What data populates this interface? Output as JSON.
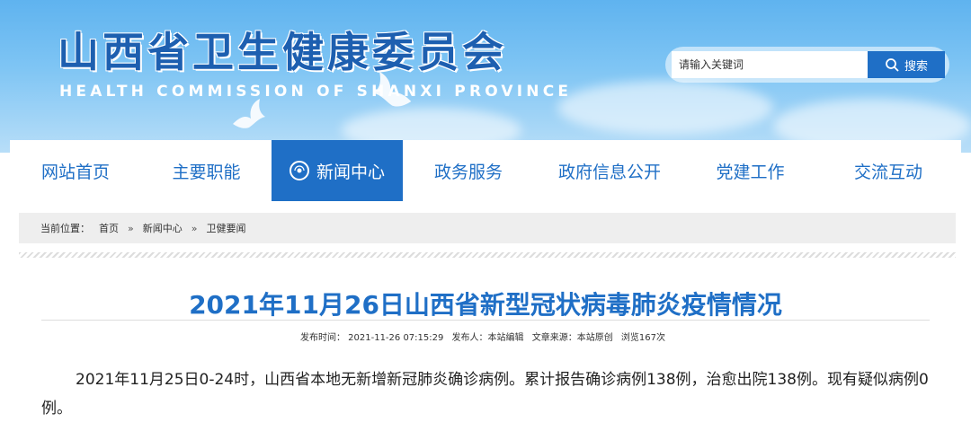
{
  "header": {
    "title": "山西省卫生健康委员会",
    "subtitle": "HEALTH COMMISSION OF SHANXI PROVINCE"
  },
  "search": {
    "placeholder": "请输入关键词",
    "button_label": "搜索",
    "icon": "search-icon"
  },
  "nav": {
    "items": [
      {
        "label": "网站首页"
      },
      {
        "label": "主要职能"
      },
      {
        "label": "新闻中心",
        "active": true,
        "icon": "globe-icon"
      },
      {
        "label": "政务服务"
      },
      {
        "label": "政府信息公开"
      },
      {
        "label": "党建工作"
      },
      {
        "label": "交流互动"
      }
    ]
  },
  "breadcrumb": {
    "prefix": "当前位置：",
    "items": [
      "首页",
      "新闻中心",
      "卫健要闻"
    ],
    "separator": "»"
  },
  "article": {
    "title": "2021年11月26日山西省新型冠状病毒肺炎疫情情况",
    "meta": {
      "publish_time": "发布时间： 2021-11-26 07:15:29",
      "publisher": "发布人：本站编辑",
      "source": "文章来源：本站原创",
      "views": "浏览167次"
    },
    "body": "2021年11月25日0-24时，山西省本地无新增新冠肺炎确诊病例。累计报告确诊病例138例，治愈出院138例。现有疑似病例0例。"
  },
  "colors": {
    "brand_blue": "#1f6fc6",
    "banner_sky": "#7fc5f4",
    "breadcrumb_bg": "#eeeeee"
  }
}
